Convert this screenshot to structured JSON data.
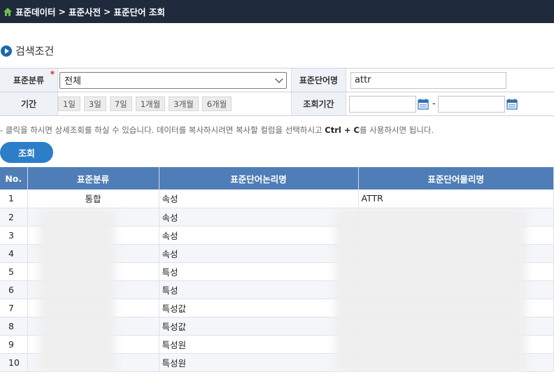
{
  "breadcrumb": {
    "items": [
      "표준데이터",
      "표준사전",
      "표준단어 조회"
    ],
    "separator": ">"
  },
  "section_title": "검색조건",
  "form": {
    "category_label": "표준분류",
    "category_value": "전체",
    "word_name_label": "표준단어명",
    "word_name_value": "attr",
    "period_label": "기간",
    "period_buttons": [
      "1일",
      "3일",
      "7일",
      "1개월",
      "3개월",
      "6개월"
    ],
    "query_period_label": "조회기간",
    "date_separator": "-"
  },
  "help": {
    "prefix": "- 클릭을 하시면 상세조회를 하실 수 있습니다. 데이터를 복사하시려면 복사할 컬럼을 선택하시고 ",
    "shortcut": "Ctrl + C",
    "suffix": "를 사용하시면 됩니다."
  },
  "search_button_label": "조회",
  "table": {
    "headers": [
      "No.",
      "표준분류",
      "표준단어논리명",
      "표준단어물리명"
    ],
    "rows": [
      {
        "no": "1",
        "category": "통합",
        "logical": "속성",
        "physical": "ATTR"
      },
      {
        "no": "2",
        "category": "",
        "logical": "속성",
        "physical": ""
      },
      {
        "no": "3",
        "category": "",
        "logical": "속성",
        "physical": ""
      },
      {
        "no": "4",
        "category": "",
        "logical": "속성",
        "physical": ""
      },
      {
        "no": "5",
        "category": "",
        "logical": "특성",
        "physical": ""
      },
      {
        "no": "6",
        "category": "",
        "logical": "특성",
        "physical": ""
      },
      {
        "no": "7",
        "category": "",
        "logical": "특성값",
        "physical": ""
      },
      {
        "no": "8",
        "category": "",
        "logical": "특성값",
        "physical": ""
      },
      {
        "no": "9",
        "category": "",
        "logical": "특성원",
        "physical": ""
      },
      {
        "no": "10",
        "category": "",
        "logical": "특성원",
        "physical": ""
      }
    ]
  },
  "colors": {
    "topbar": "#1f2a3d",
    "accent": "#2d7ec8",
    "table_header": "#4f7db7",
    "home_icon": "#6fc04a"
  }
}
